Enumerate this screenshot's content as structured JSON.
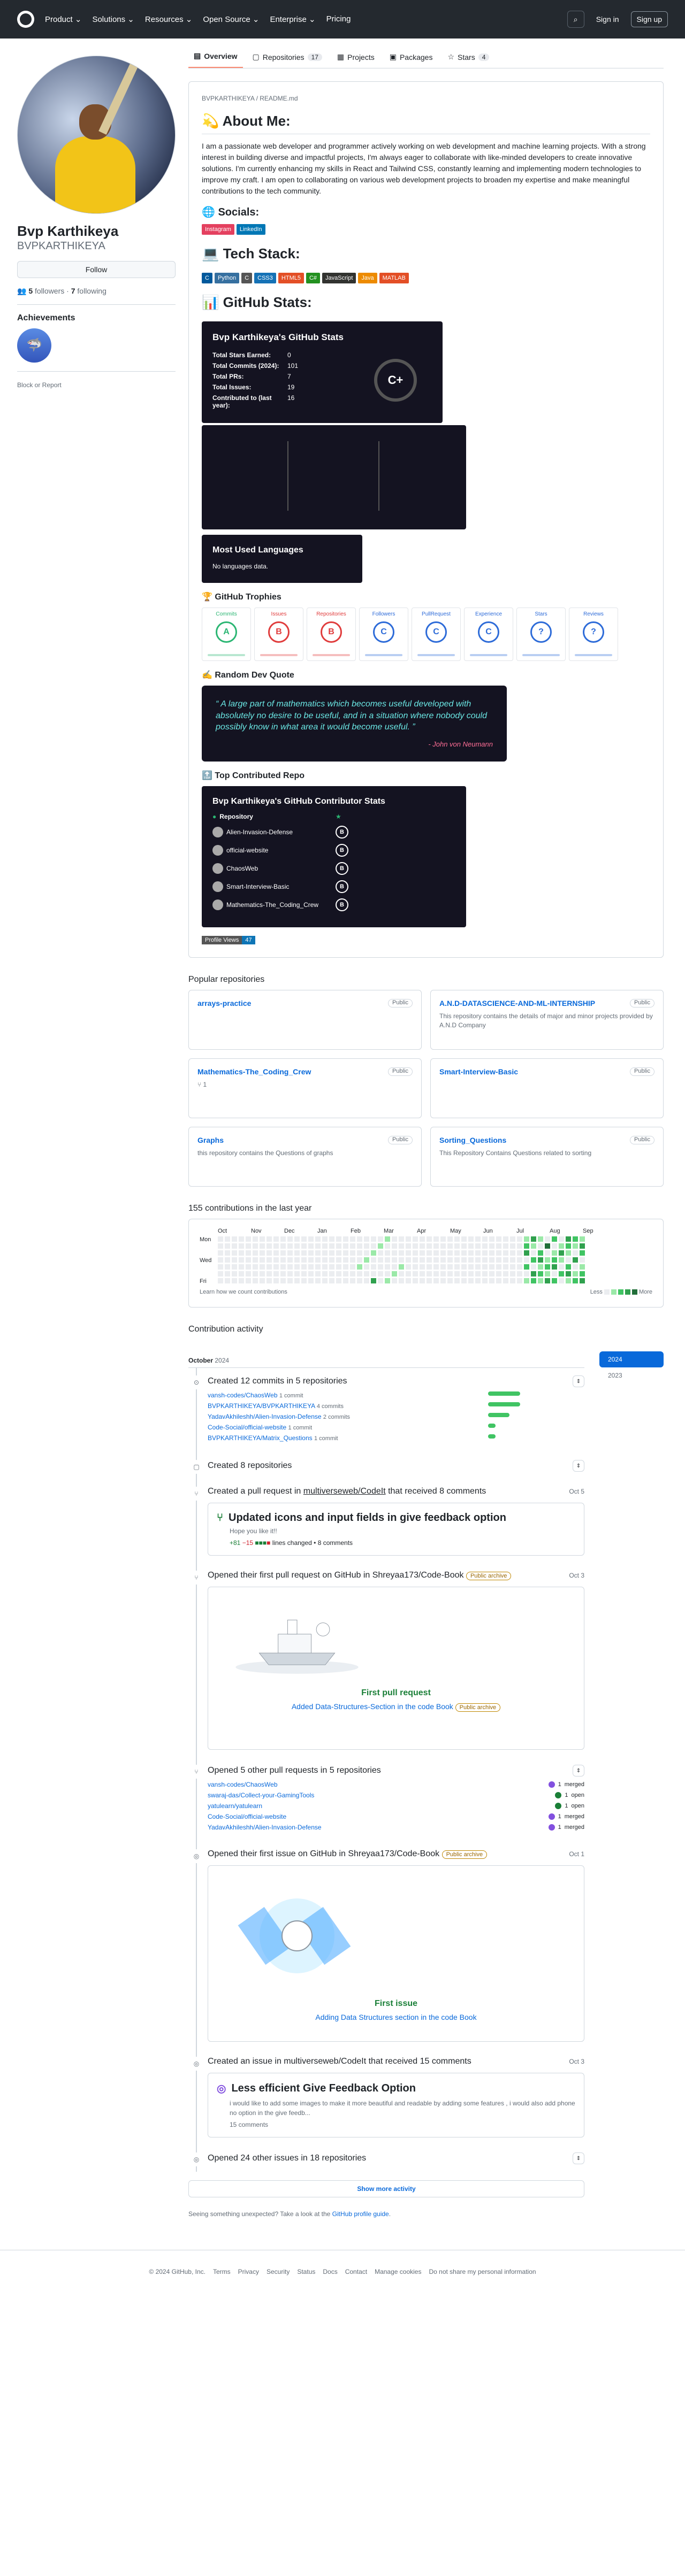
{
  "nav": {
    "items": [
      "Product",
      "Solutions",
      "Resources",
      "Open Source",
      "Enterprise",
      "Pricing"
    ],
    "signin": "Sign in",
    "signup": "Sign up"
  },
  "profile": {
    "name": "Bvp Karthikeya",
    "login": "BVPKARTHIKEYA",
    "follow": "Follow",
    "followers": "5",
    "followers_label": "followers",
    "following": "7",
    "following_label": "following",
    "achievements": "Achievements",
    "block": "Block or Report"
  },
  "tabs": [
    {
      "label": "Overview"
    },
    {
      "label": "Repositories",
      "count": "17"
    },
    {
      "label": "Projects"
    },
    {
      "label": "Packages"
    },
    {
      "label": "Stars",
      "count": "4"
    }
  ],
  "readme": {
    "path": "BVPKARTHIKEYA / README.md",
    "about_title": "💫 About Me:",
    "about": "I am a passionate web developer and programmer actively working on web development and machine learning projects. With a strong interest in building diverse and impactful projects, I'm always eager to collaborate with like-minded developers to create innovative solutions. I'm currently enhancing my skills in React and Tailwind CSS, constantly learning and implementing modern technologies to improve my craft. I am open to collaborating on various web development projects to broaden my expertise and make meaningful contributions to the tech community.",
    "socials_title": "🌐 Socials:",
    "socials": [
      {
        "label": "Instagram",
        "color": "#e4405f"
      },
      {
        "label": "LinkedIn",
        "color": "#0077b5"
      }
    ],
    "tech_title": "💻 Tech Stack:",
    "tech": [
      {
        "label": "C",
        "color": "#00599c"
      },
      {
        "label": "Python",
        "color": "#3670a0"
      },
      {
        "label": "C",
        "color": "#555"
      },
      {
        "label": "CSS3",
        "color": "#1572b6"
      },
      {
        "label": "HTML5",
        "color": "#e34f26"
      },
      {
        "label": "C#",
        "color": "#239120"
      },
      {
        "label": "JavaScript",
        "color": "#323330"
      },
      {
        "label": "Java",
        "color": "#ed8b00"
      },
      {
        "label": "MATLAB",
        "color": "#e34f26"
      }
    ],
    "stats_title": "📊 GitHub Stats:",
    "stats": {
      "title": "Bvp Karthikeya's GitHub Stats",
      "rows": [
        {
          "k": "Total Stars Earned:",
          "v": "0"
        },
        {
          "k": "Total Commits (2024):",
          "v": "101"
        },
        {
          "k": "Total PRs:",
          "v": "7"
        },
        {
          "k": "Total Issues:",
          "v": "19"
        },
        {
          "k": "Contributed to (last year):",
          "v": "16"
        }
      ],
      "grade": "C+"
    },
    "langs": {
      "title": "Most Used Languages",
      "text": "No languages data."
    },
    "trophies_title": "🏆 GitHub Trophies",
    "trophies": [
      {
        "n": "Commits",
        "g": "A",
        "c": "#2bb673"
      },
      {
        "n": "Issues",
        "g": "B",
        "c": "#e03c3c"
      },
      {
        "n": "Repositories",
        "g": "B",
        "c": "#e03c3c"
      },
      {
        "n": "Followers",
        "g": "C",
        "c": "#2d6bd8"
      },
      {
        "n": "PullRequest",
        "g": "C",
        "c": "#2d6bd8"
      },
      {
        "n": "Experience",
        "g": "C",
        "c": "#2d6bd8"
      },
      {
        "n": "Stars",
        "g": "?",
        "c": "#2d6bd8"
      },
      {
        "n": "Reviews",
        "g": "?",
        "c": "#2d6bd8"
      }
    ],
    "quote_title": "✍️ Random Dev Quote",
    "quote": "A large part of mathematics which becomes useful developed with absolutely no desire to be useful, and in a situation where nobody could possibly know in what area it would become useful.",
    "quote_author": "- John von Neumann",
    "top_title": "🔝 Top Contributed Repo",
    "contrib": {
      "title": "Bvp Karthikeya's GitHub Contributor Stats",
      "header": "Repository",
      "repos": [
        {
          "n": "Alien-Invasion-Defense",
          "r": "B"
        },
        {
          "n": "official-website",
          "r": "B"
        },
        {
          "n": "ChaosWeb",
          "r": "B"
        },
        {
          "n": "Smart-Interview-Basic",
          "r": "B"
        },
        {
          "n": "Mathematics-The_Coding_Crew",
          "r": "B"
        }
      ]
    },
    "views": {
      "label": "Profile Views",
      "count": "47"
    }
  },
  "popular": {
    "title": "Popular repositories",
    "public": "Public",
    "repos": [
      {
        "n": "arrays-practice",
        "d": ""
      },
      {
        "n": "A.N.D-DATASCIENCE-AND-ML-INTERNSHIP",
        "d": "This repository contains the details of major and minor projects provided by A.N.D Company"
      },
      {
        "n": "Mathematics-The_Coding_Crew",
        "d": "",
        "forks": "1"
      },
      {
        "n": "Smart-Interview-Basic",
        "d": ""
      },
      {
        "n": "Graphs",
        "d": "this repository contains the Questions of graphs"
      },
      {
        "n": "Sorting_Questions",
        "d": "This Repository Contains Questions related to sorting"
      }
    ]
  },
  "calendar": {
    "title": "155 contributions in the last year",
    "months": [
      "Oct",
      "Nov",
      "Dec",
      "Jan",
      "Feb",
      "Mar",
      "Apr",
      "May",
      "Jun",
      "Jul",
      "Aug",
      "Sep"
    ],
    "days": [
      "Mon",
      "Wed",
      "Fri"
    ],
    "learn": "Learn how we count contributions",
    "less": "Less",
    "more": "More"
  },
  "activity": {
    "title": "Contribution activity",
    "month": "October",
    "year": "2024",
    "years": [
      "2024",
      "2023"
    ],
    "commits": {
      "h": "Created 12 commits in 5 repositories",
      "repos": [
        {
          "n": "vansh-codes/ChaosWeb",
          "c": "1 commit",
          "w": 60
        },
        {
          "n": "BVPKARTHIKEYA/BVPKARTHIKEYA",
          "c": "4 commits",
          "w": 60
        },
        {
          "n": "YadavAkhileshh/Alien-Invasion-Defense",
          "c": "2 commits",
          "w": 40
        },
        {
          "n": "Code-Social/official-website",
          "c": "1 commit",
          "w": 14
        },
        {
          "n": "BVPKARTHIKEYA/Matrix_Questions",
          "c": "1 commit",
          "w": 14
        }
      ]
    },
    "repos8": "Created 8 repositories",
    "pr": {
      "h": "Created a pull request in",
      "repo": "multiverseweb/CodeIt",
      "tail": "that received 8 comments",
      "date": "Oct 5",
      "title": "Updated icons and input fields in give feedback option",
      "body": "Hope you like it!!",
      "add": "+81",
      "del": "−15",
      "lines": "lines changed",
      "comments": "8 comments"
    },
    "firstpr": {
      "h": "Opened their first pull request on GitHub in Shreyaa173/Code-Book",
      "tag": "Public archive",
      "date": "Oct 3",
      "label": "First pull request",
      "link": "Added Data-Structures-Section in the code Book",
      "tag2": "Public archive"
    },
    "prs5": {
      "h": "Opened 5 other pull requests in 5 repositories",
      "items": [
        {
          "n": "vansh-codes/ChaosWeb",
          "s": "merged",
          "c": "#8250df",
          "cnt": "1"
        },
        {
          "n": "swaraj-das/Collect-your-GamingTools",
          "s": "open",
          "c": "#1a7f37",
          "cnt": "1"
        },
        {
          "n": "yatulearn/yatulearn",
          "s": "open",
          "c": "#1a7f37",
          "cnt": "1"
        },
        {
          "n": "Code-Social/official-website",
          "s": "merged",
          "c": "#8250df",
          "cnt": "1"
        },
        {
          "n": "YadavAkhileshh/Alien-Invasion-Defense",
          "s": "merged",
          "c": "#8250df",
          "cnt": "1"
        }
      ]
    },
    "firstissue": {
      "h": "Opened their first issue on GitHub in Shreyaa173/Code-Book",
      "tag": "Public archive",
      "date": "Oct 1",
      "label": "First issue",
      "link": "Adding Data Structures section in the code Book"
    },
    "issue": {
      "h": "Created an issue in multiverseweb/CodeIt that received 15 comments",
      "date": "Oct 3",
      "title": "Less efficient Give Feedback Option",
      "body": "i would like to add some images to make it more beautiful and readable by adding some features , i would also add phone no option in the give feedb...",
      "comments": "15 comments"
    },
    "other": "Opened 24 other issues in 18 repositories",
    "show": "Show more activity",
    "unexpected": "Seeing something unexpected? Take a look at the",
    "guide": "GitHub profile guide"
  },
  "footer": [
    "© 2024 GitHub, Inc.",
    "Terms",
    "Privacy",
    "Security",
    "Status",
    "Docs",
    "Contact",
    "Manage cookies",
    "Do not share my personal information"
  ]
}
